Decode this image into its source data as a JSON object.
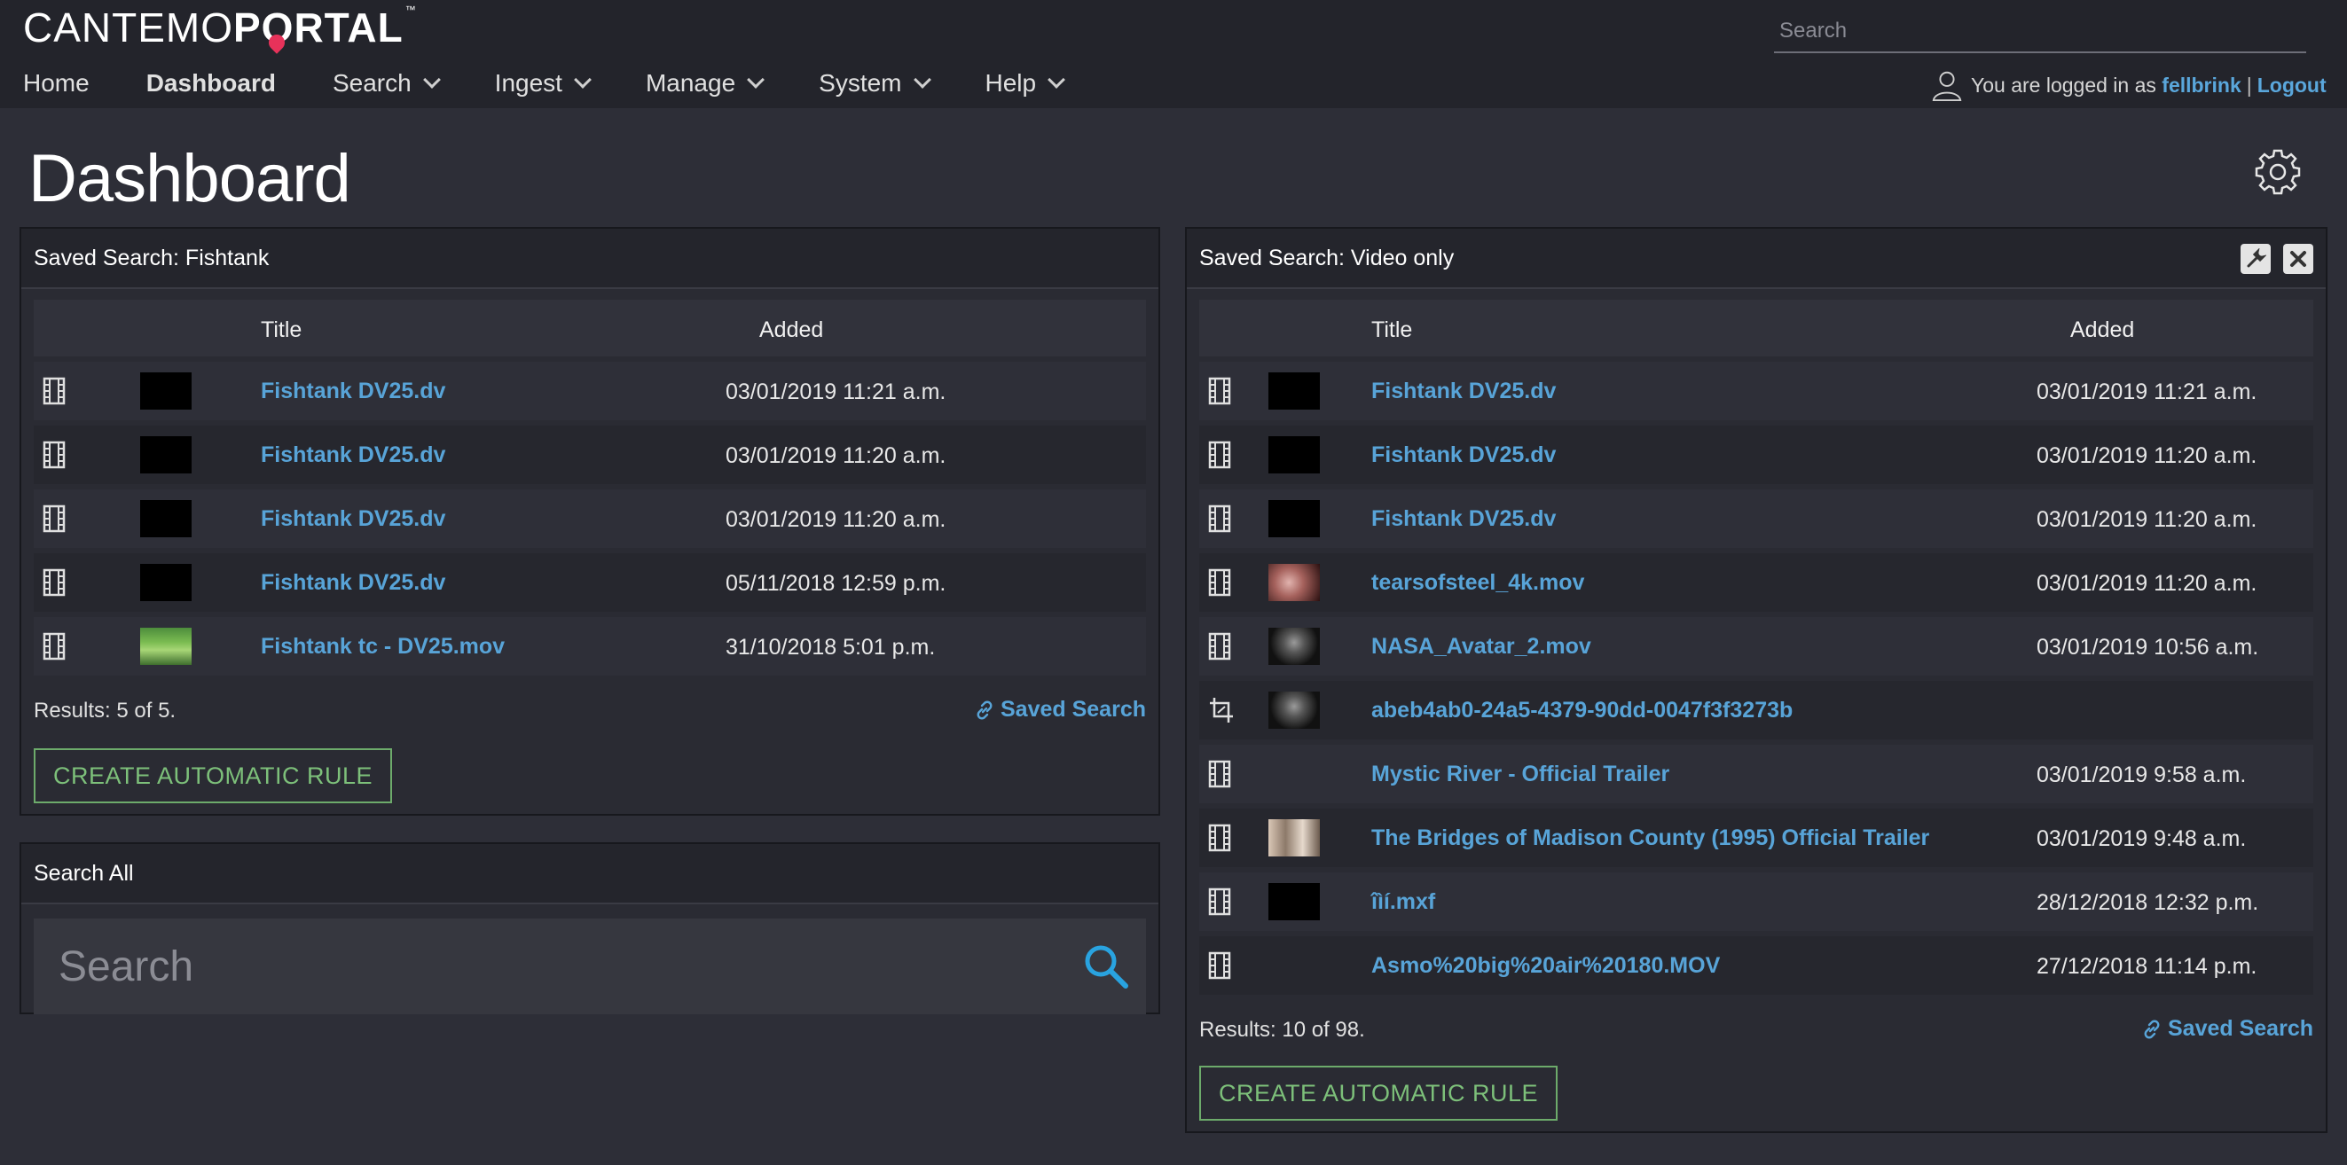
{
  "app": {
    "logo_light": "CANTEMO",
    "logo_bold": "PORTAL",
    "logo_tm": "™"
  },
  "topbar": {
    "search_placeholder": "Search"
  },
  "nav": {
    "items": [
      {
        "label": "Home",
        "active": false,
        "dropdown": false
      },
      {
        "label": "Dashboard",
        "active": true,
        "dropdown": false
      },
      {
        "label": "Search",
        "active": false,
        "dropdown": true
      },
      {
        "label": "Ingest",
        "active": false,
        "dropdown": true
      },
      {
        "label": "Manage",
        "active": false,
        "dropdown": true
      },
      {
        "label": "System",
        "active": false,
        "dropdown": true
      },
      {
        "label": "Help",
        "active": false,
        "dropdown": true
      }
    ]
  },
  "user": {
    "prefix": "You are logged in as",
    "username": "fellbrink",
    "separator": "|",
    "logout": "Logout"
  },
  "page": {
    "title": "Dashboard"
  },
  "panel_fishtank": {
    "header": "Saved Search: Fishtank",
    "col_title": "Title",
    "col_added": "Added",
    "rows": [
      {
        "icon": "film-icon",
        "thumb": "black",
        "title": "Fishtank DV25.dv",
        "added": "03/01/2019 11:21 a.m."
      },
      {
        "icon": "film-icon",
        "thumb": "black",
        "title": "Fishtank DV25.dv",
        "added": "03/01/2019 11:20 a.m."
      },
      {
        "icon": "film-icon",
        "thumb": "black",
        "title": "Fishtank DV25.dv",
        "added": "03/01/2019 11:20 a.m."
      },
      {
        "icon": "film-icon",
        "thumb": "black",
        "title": "Fishtank DV25.dv",
        "added": "05/11/2018 12:59 p.m."
      },
      {
        "icon": "film-icon",
        "thumb": "forest",
        "title": "Fishtank tc - DV25.mov",
        "added": "31/10/2018 5:01 p.m."
      }
    ],
    "results": "Results: 5 of 5.",
    "saved_search": "Saved Search",
    "rule_button": "CREATE AUTOMATIC RULE"
  },
  "panel_search_all": {
    "header": "Search All",
    "placeholder": "Search"
  },
  "panel_video": {
    "header": "Saved Search: Video only",
    "col_title": "Title",
    "col_added": "Added",
    "rows": [
      {
        "icon": "film-icon",
        "thumb": "black",
        "title": "Fishtank DV25.dv",
        "added": "03/01/2019 11:21 a.m."
      },
      {
        "icon": "film-icon",
        "thumb": "black",
        "title": "Fishtank DV25.dv",
        "added": "03/01/2019 11:20 a.m."
      },
      {
        "icon": "film-icon",
        "thumb": "black",
        "title": "Fishtank DV25.dv",
        "added": "03/01/2019 11:20 a.m."
      },
      {
        "icon": "film-icon",
        "thumb": "tears",
        "title": "tearsofsteel_4k.mov",
        "added": "03/01/2019 11:20 a.m."
      },
      {
        "icon": "film-icon",
        "thumb": "nasa",
        "title": "NASA_Avatar_2.mov",
        "added": "03/01/2019 10:56 a.m."
      },
      {
        "icon": "crop-icon",
        "thumb": "nasa",
        "title": "abeb4ab0-24a5-4379-90dd-0047f3f3273b",
        "added": ""
      },
      {
        "icon": "film-icon",
        "thumb": "none",
        "title": "Mystic River - Official Trailer",
        "added": "03/01/2019 9:58 a.m."
      },
      {
        "icon": "film-icon",
        "thumb": "bridges",
        "title": "The Bridges of Madison County (1995) Official Trailer",
        "added": "03/01/2019 9:48 a.m."
      },
      {
        "icon": "film-icon",
        "thumb": "black",
        "title": "îìí.mxf",
        "added": "28/12/2018 12:32 p.m."
      },
      {
        "icon": "film-icon",
        "thumb": "none",
        "title": "Asmo%20big%20air%20180.MOV",
        "added": "27/12/2018 11:14 p.m."
      }
    ],
    "results": "Results: 10 of 98.",
    "saved_search": "Saved Search",
    "rule_button": "CREATE AUTOMATIC RULE"
  },
  "colors": {
    "background": "#2d2e37",
    "topbar": "#23242b",
    "link": "#58a4d8",
    "rule_button": "#7dc07a",
    "search_icon": "#29a3e0",
    "logo_pin": "#e7325a"
  }
}
